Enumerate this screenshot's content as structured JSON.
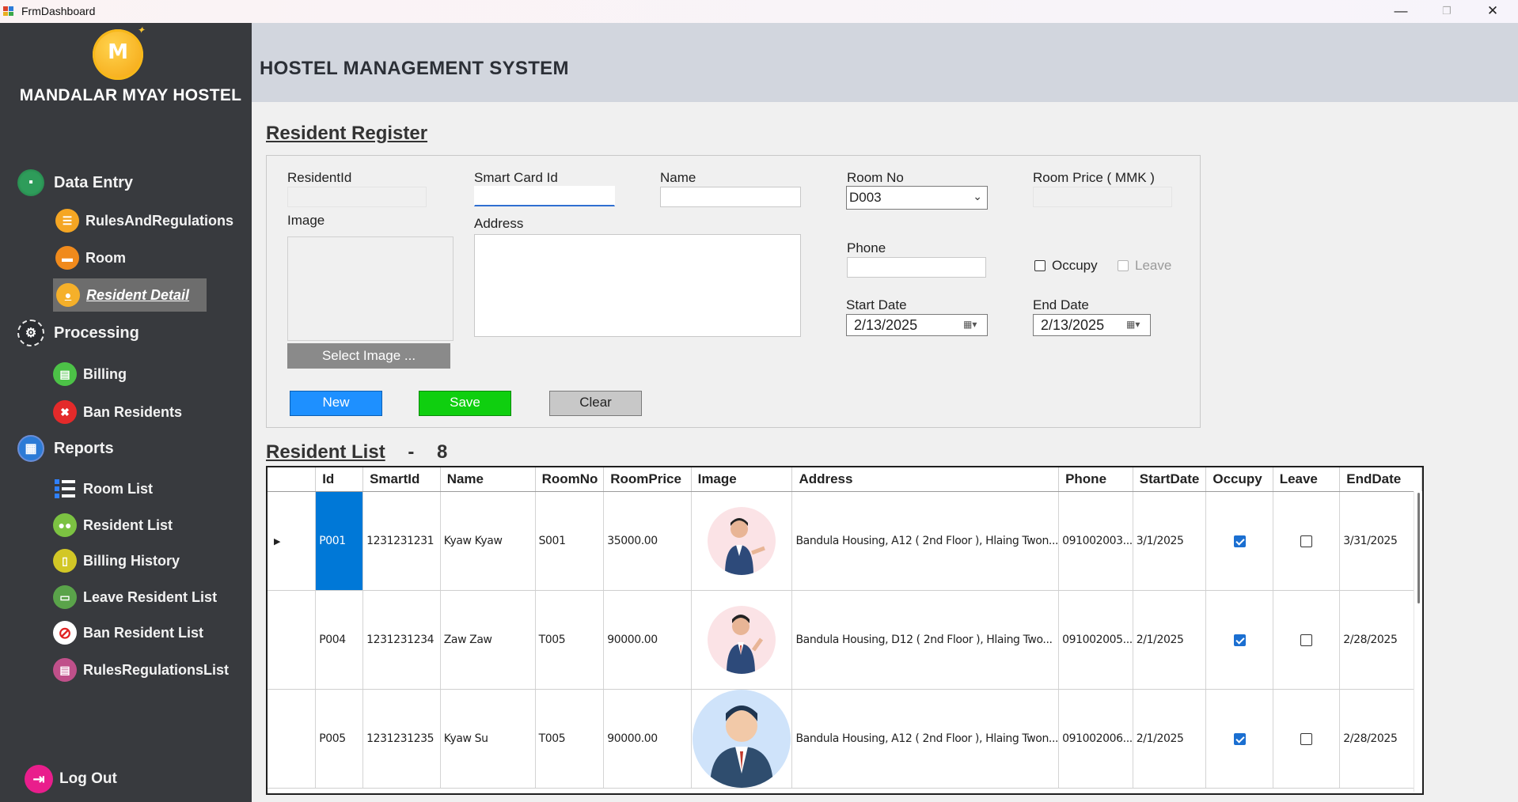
{
  "window": {
    "title": "FrmDashboard",
    "minimize": "—",
    "restore": "❐",
    "close": "✕"
  },
  "sidebar": {
    "brand": "MANDALAR MYAY HOSTEL",
    "logo_letters": "M",
    "groups": {
      "data_entry": "Data Entry",
      "processing": "Processing",
      "reports": "Reports"
    },
    "items": {
      "rules": "RulesAndRegulations",
      "room": "Room",
      "resident_detail": "Resident Detail",
      "billing": "Billing",
      "ban_residents": "Ban Residents",
      "room_list": "Room List",
      "resident_list": "Resident List",
      "billing_history": "Billing History",
      "leave_resident_list": "Leave Resident List",
      "ban_resident_list": "Ban Resident List",
      "rules_list": "RulesRegulationsList"
    },
    "logout": "Log Out"
  },
  "header": {
    "title": "HOSTEL MANAGEMENT SYSTEM"
  },
  "register": {
    "title": "Resident Register",
    "labels": {
      "resident_id": "ResidentId",
      "smart_card": "Smart Card Id",
      "name": "Name",
      "room_no": "Room No",
      "room_price": "Room Price ( MMK )",
      "image": "Image",
      "address": "Address",
      "phone": "Phone",
      "start_date": "Start Date",
      "end_date": "End Date"
    },
    "values": {
      "resident_id": "",
      "smart_card": "",
      "name": "",
      "room_no": "D003",
      "room_price": "",
      "address": "",
      "phone": "",
      "start_date": "2/13/2025",
      "end_date": "2/13/2025"
    },
    "occupy": "Occupy",
    "leave": "Leave",
    "select_image": "Select Image ...",
    "buttons": {
      "new": "New",
      "save": "Save",
      "clear": "Clear"
    },
    "colors": {
      "new": "#1e90ff",
      "save": "#0fcf0f",
      "clear": "#c8c8c8"
    }
  },
  "list": {
    "title": "Resident List",
    "separator": "-",
    "count": "8",
    "columns": [
      "Id",
      "SmartId",
      "Name",
      "RoomNo",
      "RoomPrice",
      "Image",
      "Address",
      "Phone",
      "StartDate",
      "Occupy",
      "Leave",
      "EndDate"
    ],
    "rows": [
      {
        "id": "P001",
        "smart": "1231231231",
        "name": "Kyaw Kyaw",
        "room": "S001",
        "price": "35000.00",
        "image": "avatar-man-suit-presenting",
        "address": "Bandula Housing, A12 ( 2nd Floor ), Hlaing Twon...",
        "phone": "091002003...",
        "start": "3/1/2025",
        "occupy": true,
        "leave": false,
        "end": "3/31/2025"
      },
      {
        "id": "P004",
        "smart": "1231231234",
        "name": "Zaw Zaw",
        "room": "T005",
        "price": "90000.00",
        "image": "avatar-man-pointing",
        "address": "Bandula Housing, D12 ( 2nd Floor ), Hlaing Two...",
        "phone": "091002005...",
        "start": "2/1/2025",
        "occupy": true,
        "leave": false,
        "end": "2/28/2025"
      },
      {
        "id": "P005",
        "smart": "1231231235",
        "name": "Kyaw Su",
        "room": "T005",
        "price": "90000.00",
        "image": "avatar-man-blue-circle",
        "address": "Bandula Housing, A12 ( 2nd Floor ), Hlaing Twon...",
        "phone": "091002006...",
        "start": "2/1/2025",
        "occupy": true,
        "leave": false,
        "end": "2/28/2025"
      }
    ]
  }
}
